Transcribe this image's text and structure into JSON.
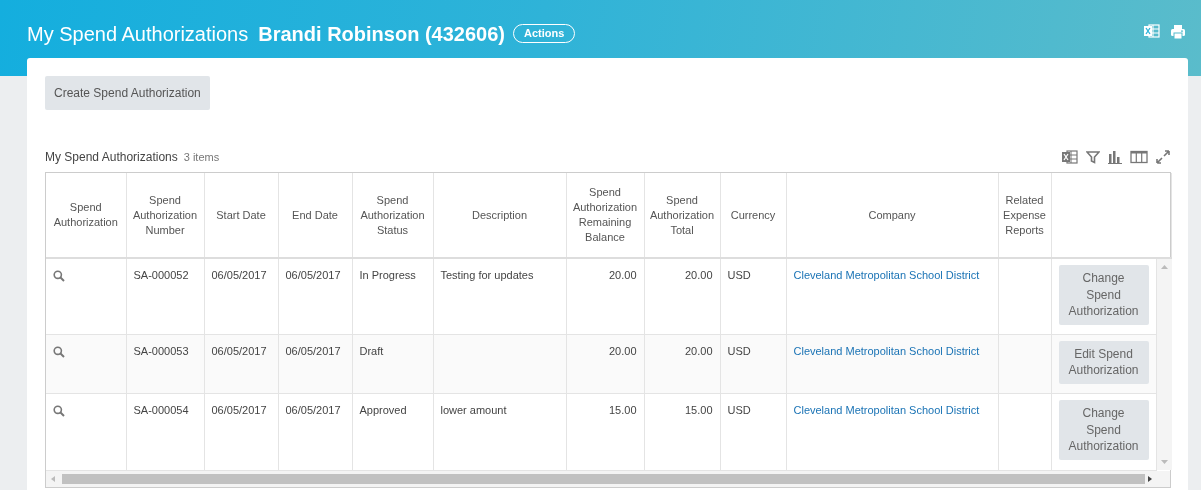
{
  "header": {
    "title": "My Spend Authorizations",
    "subject": "Brandi Robinson (432606)",
    "actions_button": "Actions"
  },
  "create_button": "Create Spend Authorization",
  "grid": {
    "title": "My Spend Authorizations",
    "count": "3 items",
    "columns": [
      "Spend Authorization",
      "Spend Authorization Number",
      "Start Date",
      "End Date",
      "Spend Authorization Status",
      "Description",
      "Spend Authorization Remaining Balance",
      "Spend Authorization Total",
      "Currency",
      "Company",
      "Related Expense Reports"
    ],
    "rows": [
      {
        "number": "SA-000052",
        "start_date": "06/05/2017",
        "end_date": "06/05/2017",
        "status": "In Progress",
        "description": "Testing for updates",
        "remaining_balance": "20.00",
        "total": "20.00",
        "currency": "USD",
        "company": "Cleveland Metropolitan School District",
        "action_button": "Change Spend Authorization"
      },
      {
        "number": "SA-000053",
        "start_date": "06/05/2017",
        "end_date": "06/05/2017",
        "status": "Draft",
        "remaining_balance": "20.00",
        "total": "20.00",
        "currency": "USD",
        "company": "Cleveland Metropolitan School District",
        "action_button": "Edit Spend Authorization"
      },
      {
        "number": "SA-000054",
        "start_date": "06/05/2017",
        "end_date": "06/05/2017",
        "status": "Approved",
        "description": "lower amount",
        "remaining_balance": "15.00",
        "total": "15.00",
        "currency": "USD",
        "company": "Cleveland Metropolitan School District",
        "action_button": "Change Spend Authorization"
      }
    ]
  }
}
